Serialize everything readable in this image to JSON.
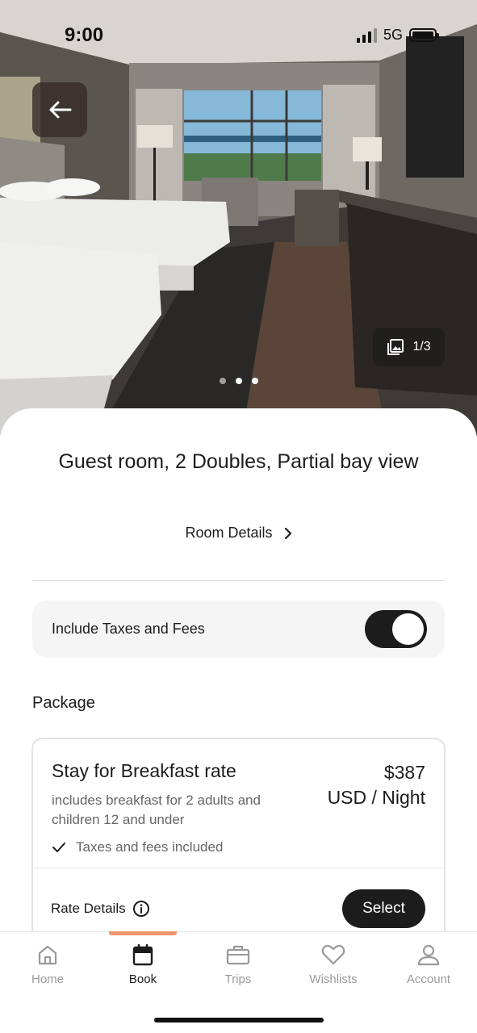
{
  "status_bar": {
    "time": "9:00",
    "network": "5G"
  },
  "hero": {
    "photo_counter": "1/3",
    "dot_count": 3,
    "active_dot": 1
  },
  "room": {
    "title": "Guest room, 2 Doubles, Partial bay view",
    "details_link": "Room Details"
  },
  "taxes_toggle": {
    "label": "Include Taxes and Fees",
    "on": true
  },
  "package": {
    "section_label": "Package",
    "rate": {
      "title": "Stay for Breakfast rate",
      "description": "includes breakfast for 2 adults and children 12 and under",
      "price_amount": "$387",
      "price_unit": "USD / Night",
      "taxes_note": "Taxes and fees included",
      "details_link": "Rate Details",
      "select_label": "Select"
    }
  },
  "tab_bar": {
    "active": "Book",
    "tabs": [
      {
        "label": "Home",
        "icon": "home-icon"
      },
      {
        "label": "Book",
        "icon": "calendar-icon"
      },
      {
        "label": "Trips",
        "icon": "briefcase-icon"
      },
      {
        "label": "Wishlists",
        "icon": "heart-icon"
      },
      {
        "label": "Account",
        "icon": "person-icon"
      }
    ]
  },
  "colors": {
    "primary": "#1c1c1c",
    "accent": "#f0956a",
    "muted": "#9a9a9a"
  }
}
